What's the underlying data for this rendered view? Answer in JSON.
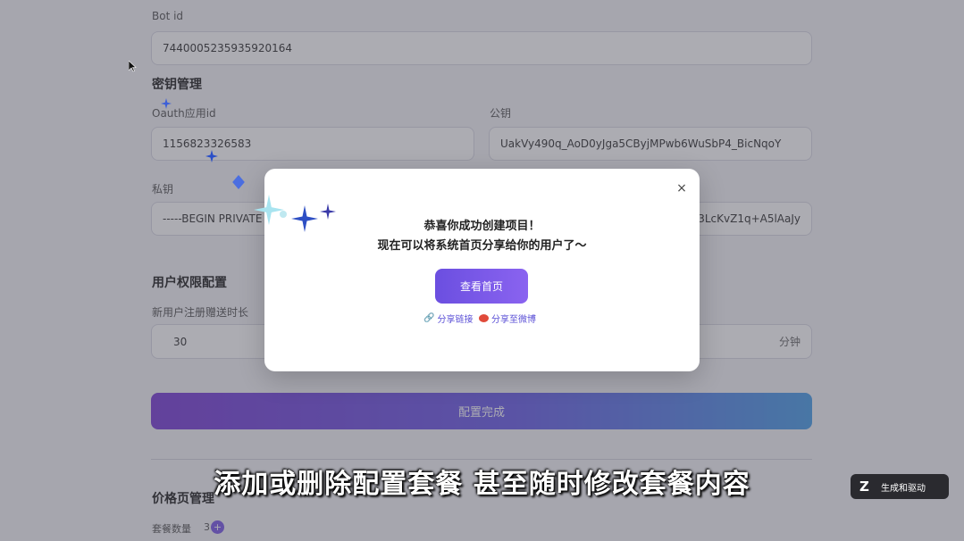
{
  "form": {
    "bot_id_label": "Bot id",
    "bot_id_value": "7440005235935920164",
    "key_section_title": "密钥管理",
    "oauth_label": "Oauth应用id",
    "oauth_value": "1156823326583",
    "public_key_label": "公钥",
    "public_key_value": "UakVy490q_AoD0yJga5CByjMPwb6WuSbP4_BicNqoY",
    "private_key_label": "私钥",
    "private_key_value": "-----BEGIN PRIVATE",
    "private_key_tail": "qd3LcKvZ1q+A5lAaJy",
    "permission_section_title": "用户权限配置",
    "trial_label": "新用户注册赠送时长",
    "trial_value": "30",
    "trial_unit": "分钟",
    "submit_label": "配置完成",
    "price_section_title": "价格页管理",
    "package_count_label": "套餐数量",
    "package_count_value": "3",
    "add_symbol": "+"
  },
  "modal": {
    "close_symbol": "×",
    "title_line1": "恭喜你成功创建项目！",
    "title_line2": "现在可以将系统首页分享给你的用户了～",
    "view_home_label": "查看首页",
    "share_link_label": "分享链接",
    "share_weibo_label": "分享至微博"
  },
  "subtitle": "添加或删除配置套餐 甚至随时修改套餐内容",
  "watermark": {
    "label": "生成和驱动"
  },
  "colors": {
    "accent_start": "#7a3dd6",
    "accent_end": "#4a9ee8",
    "modal_button": "#7a5ae8"
  }
}
